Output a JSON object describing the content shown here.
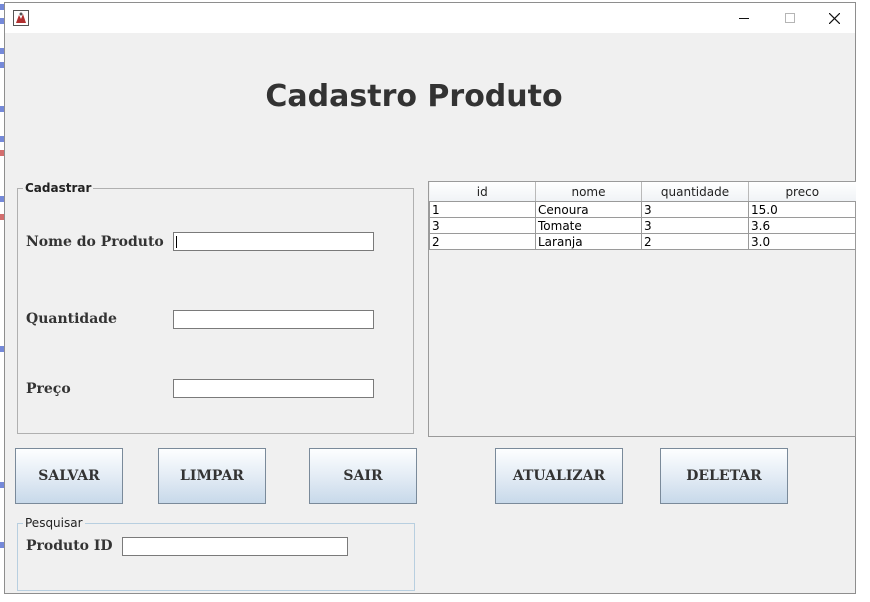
{
  "window": {
    "title": "",
    "controls": {
      "minimize_icon": "minimize-icon",
      "maximize_icon": "maximize-icon",
      "close_icon": "close-icon"
    }
  },
  "header": {
    "title": "Cadastro Produto"
  },
  "cadastrar": {
    "legend": "Cadastrar",
    "fields": [
      {
        "label": "Nome do Produto",
        "value": ""
      },
      {
        "label": "Quantidade",
        "value": ""
      },
      {
        "label": "Preço",
        "value": ""
      }
    ]
  },
  "table": {
    "columns": [
      "id",
      "nome",
      "quantidade",
      "preco"
    ],
    "rows": [
      [
        "1",
        "Cenoura",
        "3",
        "15.0"
      ],
      [
        "3",
        "Tomate",
        "3",
        "3.6"
      ],
      [
        "2",
        "Laranja",
        "2",
        "3.0"
      ]
    ]
  },
  "buttons": {
    "salvar": "SALVAR",
    "limpar": "LIMPAR",
    "sair": "SAIR",
    "atualizar": "ATUALIZAR",
    "deletar": "DELETAR"
  },
  "pesquisar": {
    "legend": "Pesquisar",
    "label": "Produto ID",
    "value": ""
  },
  "colors": {
    "window_bg": "#f0f0f0",
    "title_text": "#333333",
    "button_gradient_top": "#fdfeff",
    "button_gradient_bottom": "#c8d9ea"
  }
}
